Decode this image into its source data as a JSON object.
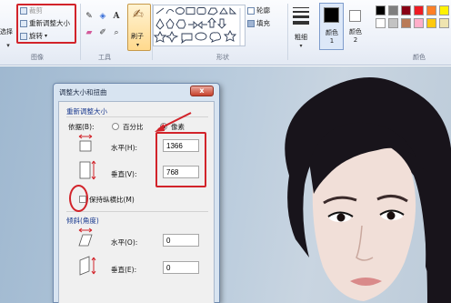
{
  "ribbon": {
    "image_group": {
      "label": "图像",
      "select_label": "选择",
      "crop_label": "裁剪",
      "resize_label": "重新调整大小",
      "rotate_label": "旋转"
    },
    "tools_group": {
      "label": "工具"
    },
    "brush_label": "刷子",
    "shapes_group": {
      "label": "形状",
      "outline_label": "轮廓",
      "fill_label": "填充"
    },
    "size_label": "粗细",
    "color1_label": "颜色 1",
    "color2_label": "颜色 2",
    "colors_group": {
      "label": "颜色"
    },
    "palette": [
      "#000000",
      "#7f7f7f",
      "#880015",
      "#ed1c24",
      "#ff7f27",
      "#fff200",
      "#ffffff",
      "#c3c3c3",
      "#b97a57",
      "#ffaec9",
      "#ffc90e",
      "#efe4b0"
    ]
  },
  "dialog": {
    "title": "调整大小和扭曲",
    "close_glyph": "x",
    "resize_section": "重新调整大小",
    "by_label": "依据(B):",
    "percent_label": "百分比",
    "pixels_label": "像素",
    "horizontal_label": "水平(H):",
    "horizontal_value": "1366",
    "vertical_label": "垂直(V):",
    "vertical_value": "768",
    "keep_ratio_label": "保持纵横比(M)",
    "skew_section": "倾斜(角度)",
    "skew_horizontal_label": "水平(O):",
    "skew_horizontal_value": "0",
    "skew_vertical_label": "垂直(E):",
    "skew_vertical_value": "0"
  },
  "colors": {
    "highlight": "#d2232a",
    "accent": "#1a3a8f"
  }
}
